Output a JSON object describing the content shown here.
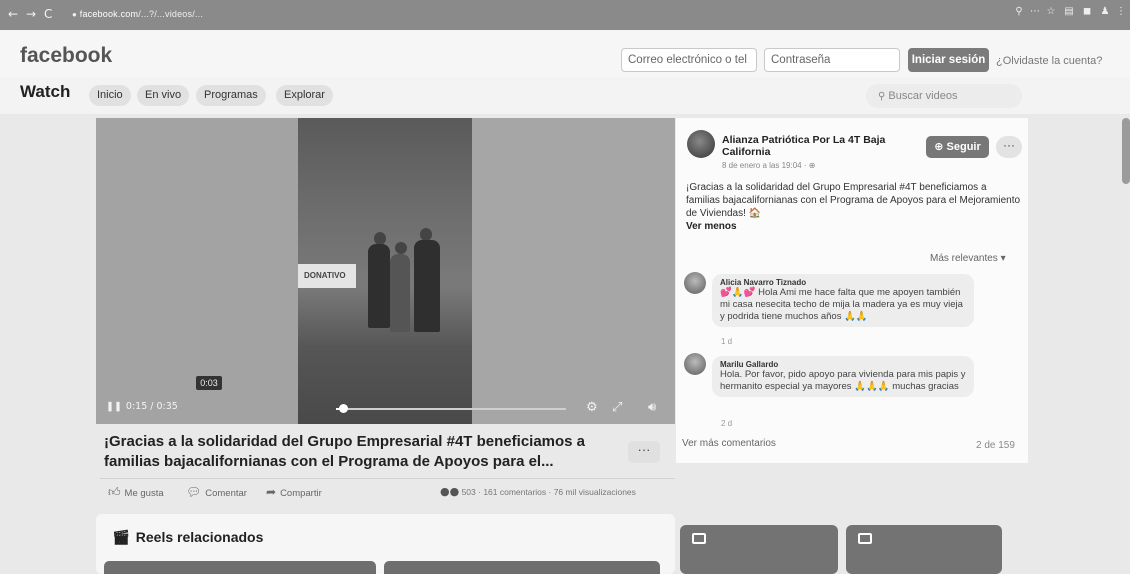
{
  "browser": {
    "back": "←",
    "forward": "→",
    "reload": "C",
    "url_host": "facebook.com",
    "url_rest": "/...?/...videos/...",
    "ext_icons": [
      "⚲",
      "⋯",
      "☆",
      "▤",
      "◼",
      "♟",
      "⋮"
    ]
  },
  "header": {
    "logo": "facebook",
    "email_placeholder": "Correo electrónico o tel",
    "password_placeholder": "Contraseña",
    "login_label": "Iniciar sesión",
    "forgot_label": "¿Olvidaste la cuenta?"
  },
  "watch": {
    "title": "Watch",
    "tabs": [
      "Inicio",
      "En vivo",
      "Programas",
      "Explorar"
    ],
    "search_placeholder": "Buscar videos",
    "search_icon": "search-icon"
  },
  "video": {
    "banner_text": "DONATIVO",
    "hover_time": "0:03",
    "time": "0:15 / 0:35",
    "progress": 0.03
  },
  "post": {
    "title": "¡Gracias a la solidaridad del Grupo Empresarial #4T beneficiamos a familias bajacalifornianas con el Programa de Apoyos para el...",
    "more": "···",
    "actions": {
      "like": "Me gusta",
      "comment": "Comentar",
      "share": "Compartir"
    },
    "reactions_summary": "503 · 161 comentarios · 76 mil visualizaciones"
  },
  "reels": {
    "title": "Reels relacionados"
  },
  "page": {
    "name": "Alianza Patriótica Por La 4T Baja California",
    "time": "8 de enero a las 19:04 · ⊕",
    "follow_label": "Seguir",
    "more": "···",
    "post_text": "¡Gracias a la solidaridad del Grupo Empresarial #4T beneficiamos a familias bajacalifornianas con el Programa de Apoyos para el Mejoramiento de Viviendas! 🏠",
    "see_less": "Ver menos"
  },
  "comments": {
    "sort": "Más relevantes ▾",
    "items": [
      {
        "name": "Alicia Navarro Tiznado",
        "text": "💕🙏💕 Hola Ami me hace falta que me apoyen también mi casa nesecita techo de mija la madera ya es muy vieja y podrida tiene muchos años 🙏🙏",
        "age": "1 d"
      },
      {
        "name": "Marilu Gallardo",
        "text": "Hola. Por favor, pido apoyo para vivienda para mis papis y hermanito especial ya mayores 🙏🙏🙏 muchas gracias",
        "age": "2 d"
      }
    ],
    "see_more": "Ver más comentarios",
    "count": "2 de 159"
  },
  "colors": {
    "chrome": "#8a8a8a",
    "button": "#7b7b7b"
  }
}
